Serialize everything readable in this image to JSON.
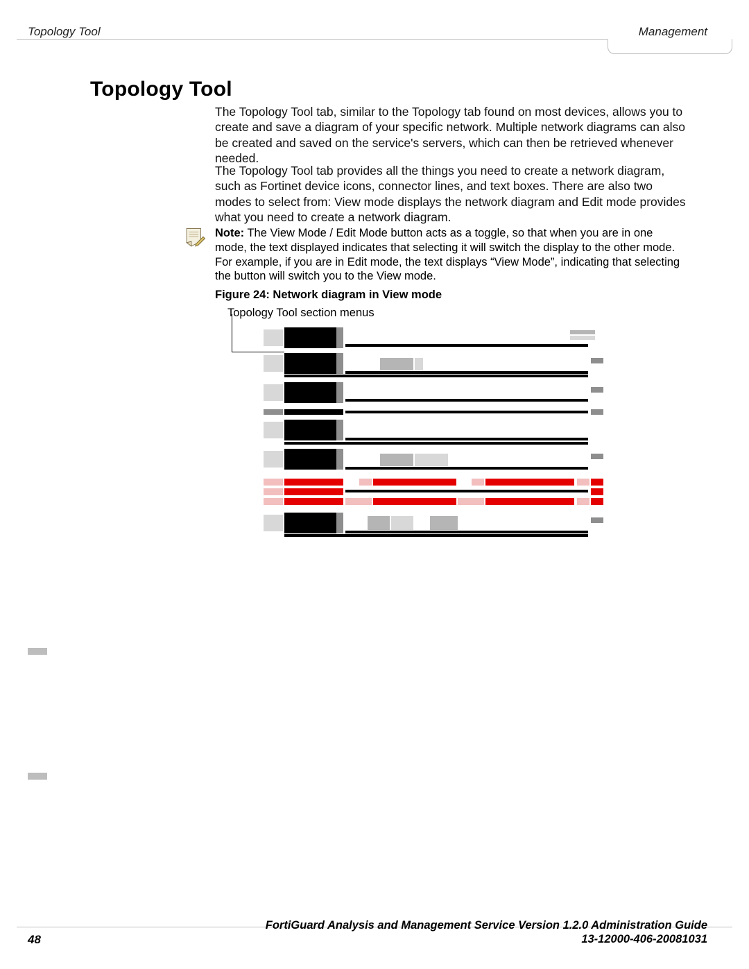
{
  "header": {
    "left": "Topology Tool",
    "right": "Management"
  },
  "title": "Topology Tool",
  "paragraphs": {
    "p1": "The Topology Tool tab, similar to the Topology tab found on most devices, allows you to create and save a diagram of your specific network. Multiple network diagrams can also be created and saved on the service's servers, which can then be retrieved whenever needed.",
    "p2": "The Topology Tool tab provides all the things you need to create a network diagram, such as Fortinet device icons, connector lines, and text boxes. There are also two modes to select from: View mode displays the network diagram and Edit mode provides what you need to create a network diagram."
  },
  "note": {
    "label": "Note:",
    "text": " The View Mode / Edit Mode button acts as a toggle, so that when you are in one mode, the text displayed indicates that selecting it will switch the display to the other mode. For example, if you are in Edit mode, the text displays “View Mode”, indicating that selecting the button will switch you to the View mode."
  },
  "figure": {
    "caption": "Figure 24: Network diagram in View mode",
    "callout": "Topology Tool section menus"
  },
  "footer": {
    "page": "48",
    "line1": "FortiGuard Analysis and Management Service Version 1.2.0 Administration Guide",
    "line2": "13-12000-406-20081031"
  }
}
